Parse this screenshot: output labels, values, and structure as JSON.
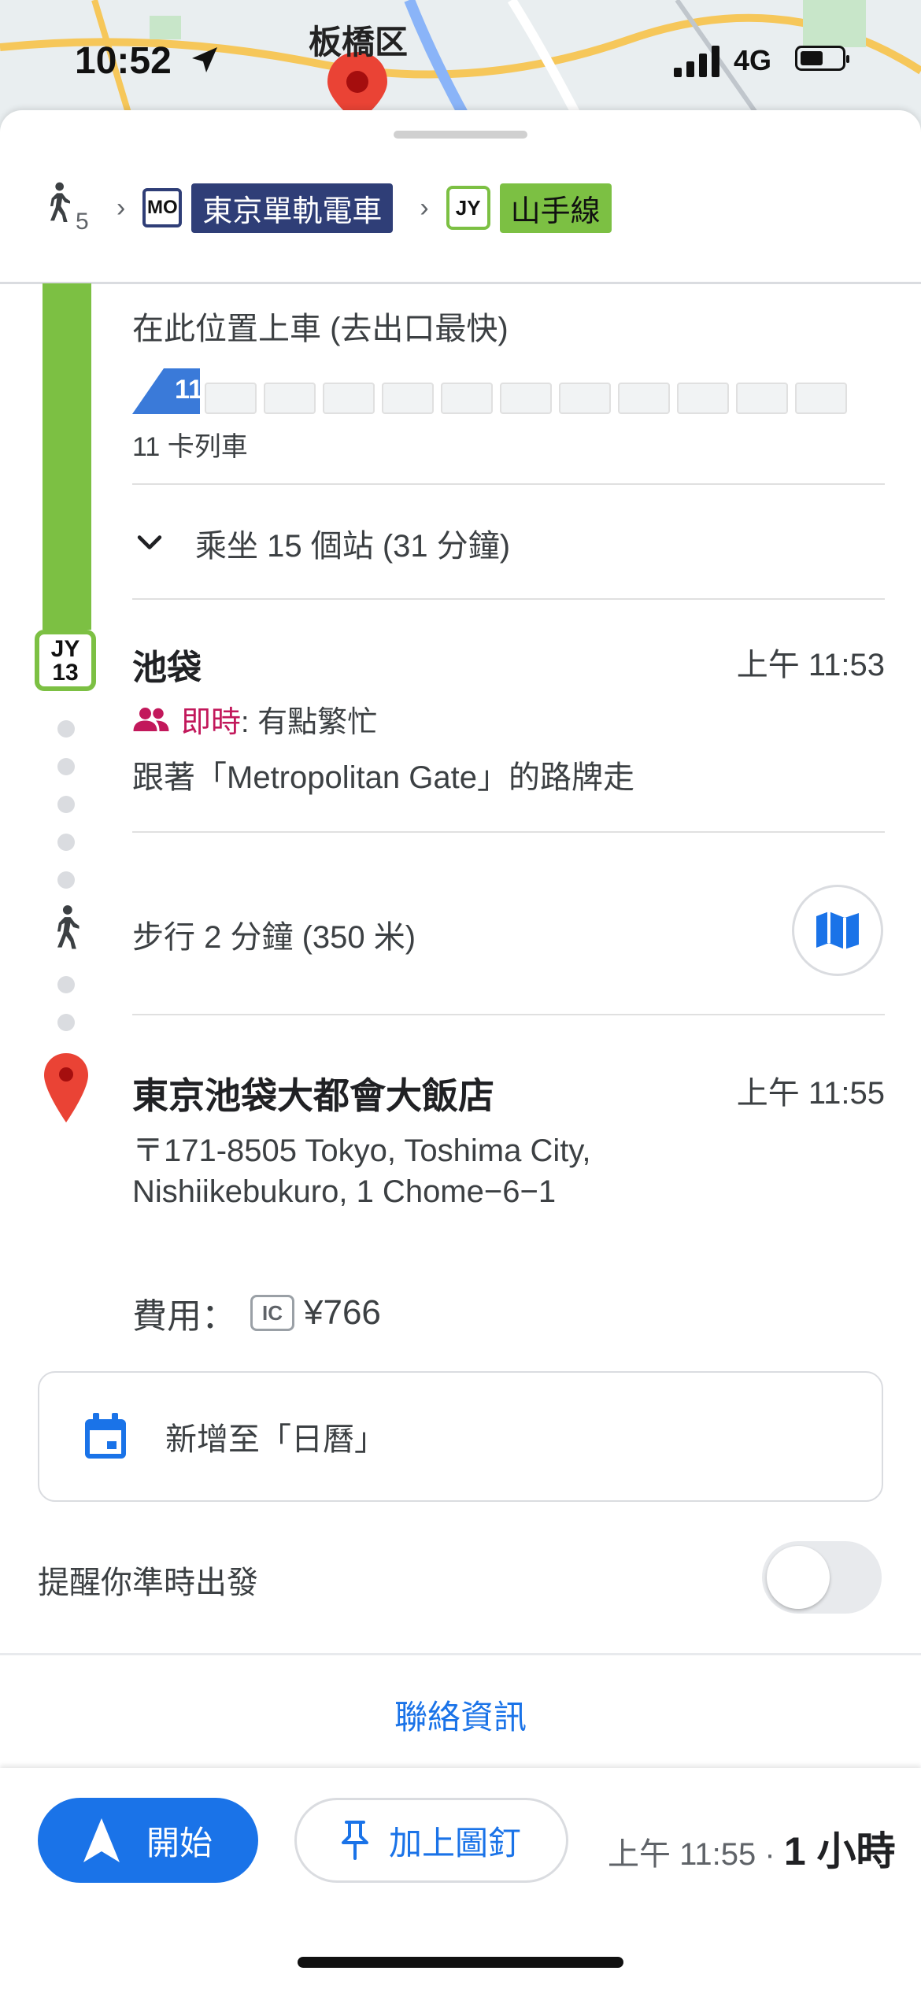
{
  "status_bar": {
    "time": "10:52",
    "network": "4G"
  },
  "map": {
    "district_label": "板橋区"
  },
  "route_summary": {
    "walk_minutes": "5",
    "line1_code": "MO",
    "line1_name": "東京單軌電車",
    "line2_code": "JY",
    "line2_name": "山手線"
  },
  "boarding": {
    "instruction": "在此位置上車 (去出口最快)",
    "front_car_number": "11",
    "cars_label": "11 卡列車"
  },
  "ride": {
    "summary": "乘坐 15 個站 (31 分鐘)"
  },
  "station": {
    "badge_line": "JY",
    "badge_number": "13",
    "name": "池袋",
    "time": "上午 11:53",
    "crowd_live_label": "即時",
    "crowd_status": ": 有點繁忙",
    "signage": "跟著「Metropolitan Gate」的路牌走"
  },
  "walk": {
    "text": "步行 2 分鐘 (350 米)"
  },
  "destination": {
    "name": "東京池袋大都會大飯店",
    "time": "上午 11:55",
    "address_line1": "〒171-8505 Tokyo, Toshima City,",
    "address_line2": "Nishiikebukuro, 1 Chome−6−1"
  },
  "fare": {
    "label": "費用：",
    "ic_label": "IC",
    "amount": "¥766"
  },
  "calendar": {
    "label": "新增至「日曆」"
  },
  "reminder": {
    "label": "提醒你準時出發",
    "enabled": false
  },
  "contact": {
    "label": "聯絡資訊"
  },
  "bottom": {
    "start_label": "開始",
    "pin_label": "加上圖釘",
    "arrival": "上午 11:55 ·",
    "duration": "1 小時"
  },
  "colors": {
    "yamanote_green": "#7cc043",
    "monorail_navy": "#2f3e77",
    "google_blue": "#1a73e8",
    "live_magenta": "#c2185b",
    "pin_red": "#ea4335"
  }
}
